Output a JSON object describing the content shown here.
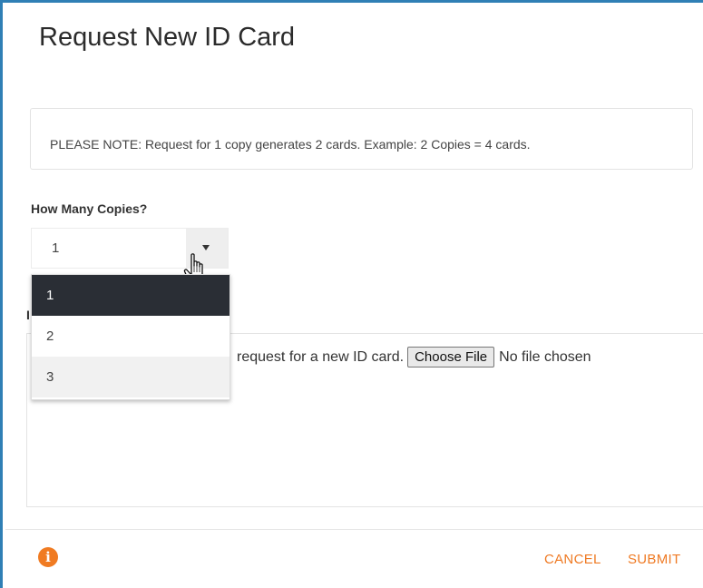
{
  "dialog": {
    "title": "Request New ID Card",
    "note": "PLEASE NOTE: Request for 1 copy generates 2 cards. Example: 2 Copies = 4 cards."
  },
  "copies": {
    "label": "How Many Copies?",
    "selected_value": "1",
    "options": [
      "1",
      "2",
      "3"
    ]
  },
  "upload": {
    "label_fragment": "I",
    "instruction_fragment": "request for a new ID card.",
    "choose_button": "Choose File",
    "file_status": "No file chosen"
  },
  "footer": {
    "info_icon": "i",
    "cancel_label": "CANCEL",
    "submit_label": "SUBMIT"
  },
  "colors": {
    "accent": "#ef7a24",
    "frame_border": "#2f7fb5",
    "selected_option_bg": "#2a2e35"
  }
}
